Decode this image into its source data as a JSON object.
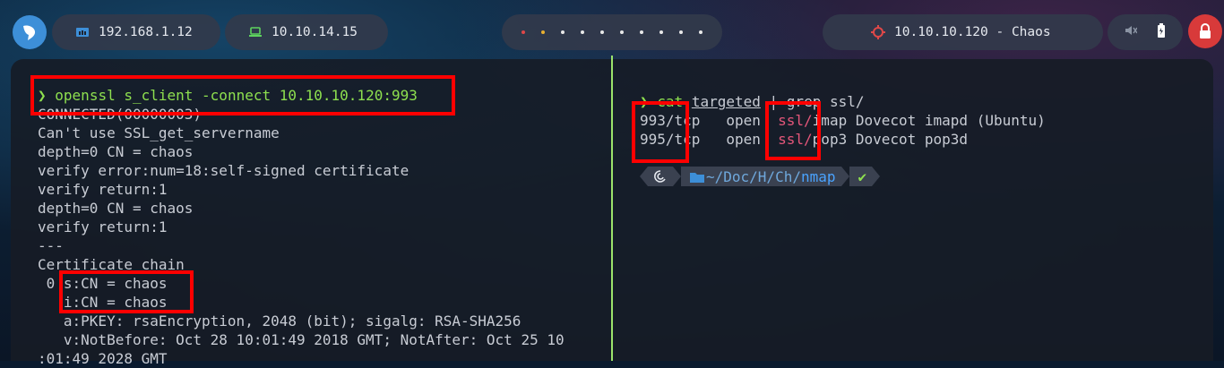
{
  "topbar": {
    "ip_local": "192.168.1.12",
    "ip_vpn": "10.10.14.15",
    "target": "10.10.10.120 - Chaos",
    "workspace_dots": 10
  },
  "left_terminal": {
    "prompt_symbol": "❯",
    "command": "openssl s_client -connect 10.10.10.120:993",
    "lines": [
      "CONNECTED(00000003)",
      "Can't use SSL_get_servername",
      "depth=0 CN = chaos",
      "verify error:num=18:self-signed certificate",
      "verify return:1",
      "depth=0 CN = chaos",
      "verify return:1",
      "---",
      "Certificate chain",
      " 0 s:CN = chaos",
      "   i:CN = chaos",
      "   a:PKEY: rsaEncryption, 2048 (bit); sigalg: RSA-SHA256",
      "   v:NotBefore: Oct 28 10:01:49 2018 GMT; NotAfter: Oct 25 10",
      ":01:49 2028 GMT"
    ]
  },
  "right_terminal": {
    "prompt_symbol": "❯",
    "cmd_cat": "cat",
    "cmd_file": "targeted",
    "cmd_pipe": "| grep ssl/",
    "rows": [
      {
        "port": "993/tcp",
        "state": "open",
        "service": "ssl/",
        "rest": "imap Dovecot imapd (Ubuntu)"
      },
      {
        "port": "995/tcp",
        "state": "open",
        "service": "ssl/",
        "rest": "pop3 Dovecot pop3d"
      }
    ],
    "path_prefix": "~/Doc/H/Ch/",
    "path_current": "nmap",
    "status_ok": "✔"
  }
}
